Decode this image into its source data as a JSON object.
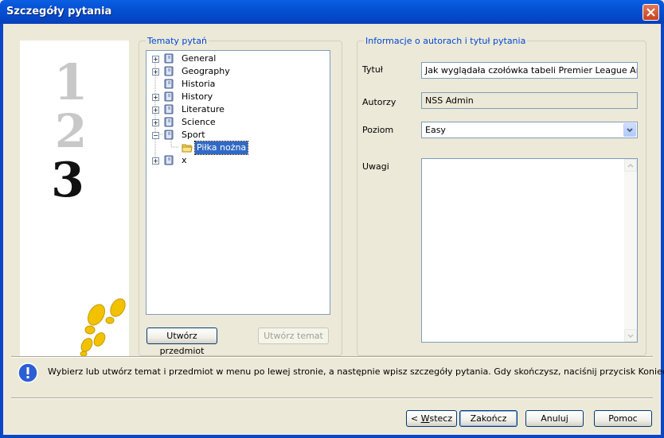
{
  "window": {
    "title": "Szczegóły pytania"
  },
  "topics": {
    "legend": "Tematy pytań",
    "items": [
      {
        "label": "General",
        "expandable": true
      },
      {
        "label": "Geography",
        "expandable": true
      },
      {
        "label": "Historia",
        "expandable": false
      },
      {
        "label": "History",
        "expandable": true
      },
      {
        "label": "Literature",
        "expandable": true
      },
      {
        "label": "Science",
        "expandable": true
      },
      {
        "label": "Sport",
        "expandable": true,
        "expanded": true
      },
      {
        "label": "Piłka nożna",
        "child": true,
        "selected": true
      },
      {
        "label": "x",
        "expandable": true
      }
    ],
    "create_subject_btn": "Utwórz przedmiot",
    "create_topic_btn": "Utwórz temat"
  },
  "info": {
    "legend": "Informacje o autorach i tytuł pytania",
    "title_label": "Tytuł",
    "title_value": "Jak wyglądała czołówka tabeli Premier League Arabii S",
    "authors_label": "Autorzy",
    "authors_value": "NSS Admin",
    "level_label": "Poziom",
    "level_value": "Easy",
    "notes_label": "Uwagi"
  },
  "hint": "Wybierz lub utwórz temat i przedmiot w menu po lewej stronie, a następnie wpisz szczegóły pytania. Gdy skończysz, naciśnij przycisk Koniec.",
  "buttons": {
    "back_prefix": "< ",
    "back_accel": "W",
    "back_rest": "stecz",
    "finish": "Zakończ",
    "cancel": "Anuluj",
    "help": "Pomoc"
  },
  "wizard_steps": {
    "step1": "1",
    "step2": "2",
    "step3": "3"
  },
  "colors": {
    "title_bar": "#0653d6",
    "accent": "#0046d5",
    "selection": "#316ac5"
  }
}
